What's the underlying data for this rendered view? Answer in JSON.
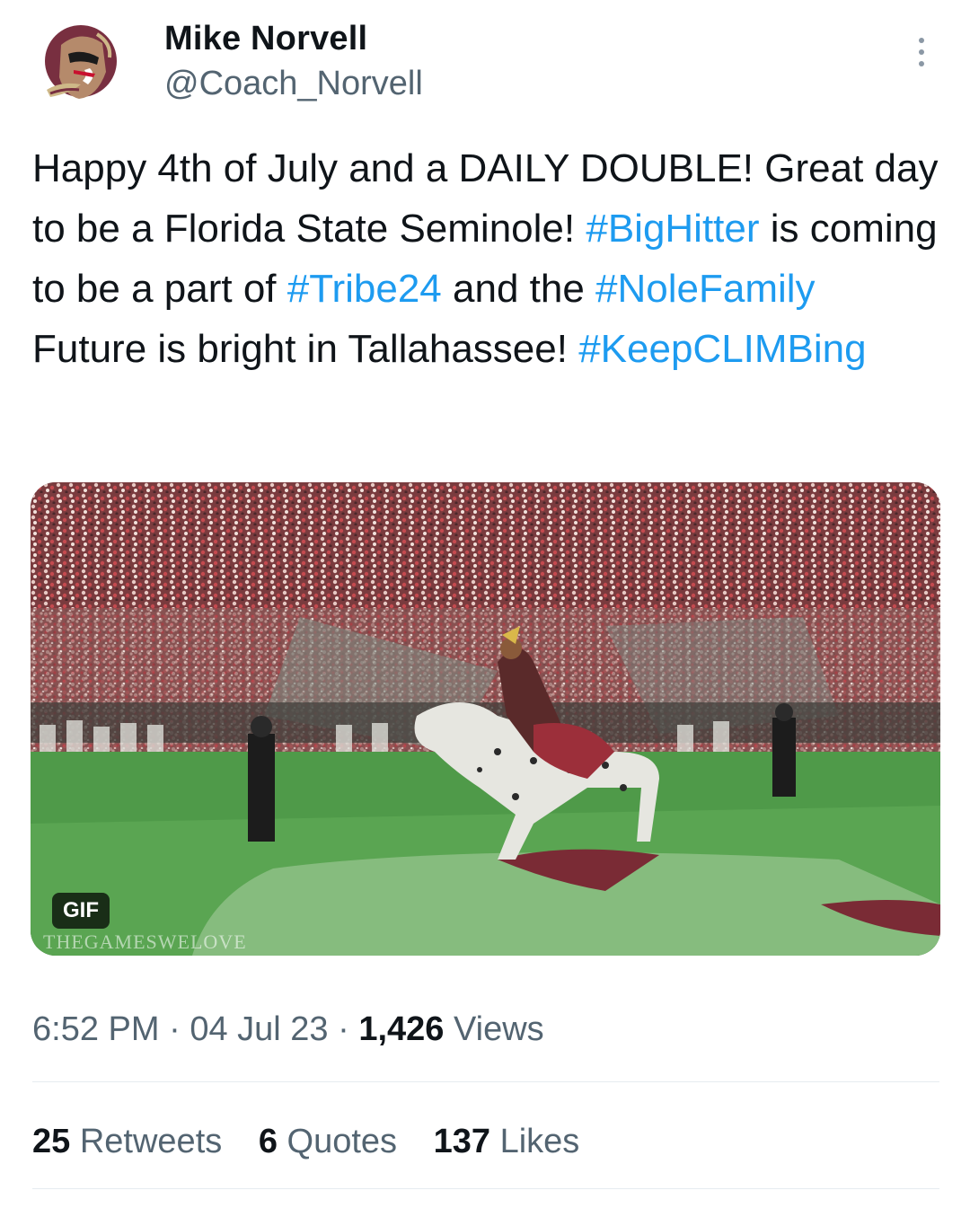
{
  "author": {
    "name": "Mike Norvell",
    "handle": "@Coach_Norvell",
    "avatar_icon": "seminoles-logo-icon"
  },
  "tweet": {
    "segments": [
      {
        "text": "Happy 4th of July and a DAILY DOUBLE! Great day to be a Florida State Seminole! ",
        "hashtag": false
      },
      {
        "text": "#BigHitter",
        "hashtag": true
      },
      {
        "text": " is coming to be a part of ",
        "hashtag": false
      },
      {
        "text": "#Tribe24",
        "hashtag": true
      },
      {
        "text": " and the ",
        "hashtag": false
      },
      {
        "text": "#NoleFamily",
        "hashtag": true
      },
      {
        "text": " Future is bright in Tallahassee! ",
        "hashtag": false
      },
      {
        "text": "#KeepCLIMBing",
        "hashtag": true
      }
    ]
  },
  "media": {
    "badge": "GIF",
    "watermark": "THEGAMESWELOVE"
  },
  "meta": {
    "time": "6:52 PM",
    "date": "04 Jul 23",
    "views_count": "1,426",
    "views_label": "Views"
  },
  "stats": {
    "retweets_count": "25",
    "retweets_label": "Retweets",
    "quotes_count": "6",
    "quotes_label": "Quotes",
    "likes_count": "137",
    "likes_label": "Likes"
  },
  "colors": {
    "hashtag": "#1d9bf0",
    "secondary_text": "#536471",
    "primary_text": "#0f1419",
    "garnet": "#782f40",
    "gold": "#ceb888"
  }
}
